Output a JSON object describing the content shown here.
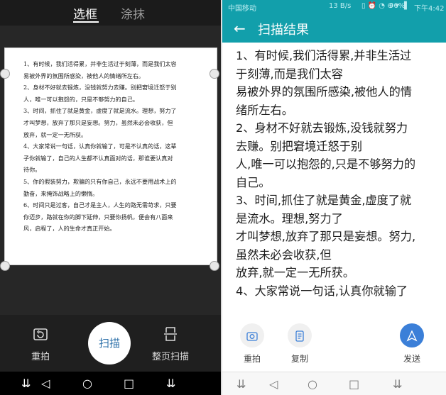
{
  "left": {
    "tabs": [
      {
        "label": "选框"
      },
      {
        "label": "涂抹"
      }
    ],
    "doc_lines": [
      "1、有时候，我们活得累，并非生活过于刻薄，而是我们太容",
      "易被外界的氛围所感染，被他人的情绪所左右。",
      "2、身材不好就去锻炼，没钱就努力去赚。别把窘境迁怒于别",
      "人，唯一可以抱怨的，只是不够努力的自己。",
      "3、时间，抓住了就是黄金，虚度了就是流水。理想，努力了",
      "才叫梦想，放弃了那只是妄想。努力，虽然未必会收获，但",
      "放弃，就一定一无所获。",
      "4、大家常说一句话，认真你就输了，可是不认真的话，这辈",
      "子你就输了，自己的人生都不认真面对的话，那谁要认真对",
      "待你。",
      "5、你的假装努力，欺骗的只有你自己，永远不要用战术上的",
      "勤奋，来掩饰战略上的懒惰。",
      "6、时间只是过客，自己才是主人，人生的路无需苛求，只要",
      "你迈步，路就在你的脚下延伸，只要你扬帆，便会有八面来",
      "风，启程了，人的生命才真正开始。"
    ],
    "bottom": {
      "retake": "重拍",
      "scan": "扫描",
      "full_page": "整页扫描"
    }
  },
  "right": {
    "status": {
      "carrier": "中国移动",
      "speed": "13 B/s",
      "battery": "96%",
      "time": "下午4:42"
    },
    "title": "扫描结果",
    "lines": [
      "1、有时候,我们活得累,并非生活过",
      "于刻薄,而是我们太容",
      "易被外界的氛围所感染,被他人的情",
      "绪所左右。",
      "2、身材不好就去锻炼,没钱就努力",
      "去赚。别把窘境迁怒于别",
      "人,唯一可以抱怨的,只是不够努力的",
      "自己。",
      "3、时间,抓住了就是黄金,虚度了就",
      "是流水。理想,努力了",
      "才叫梦想,放弃了那只是妄想。努力,",
      "虽然未必会收获,但",
      "放弃,就一定一无所获。",
      "4、大家常说一句话,认真你就输了"
    ],
    "actions": {
      "retake": "重拍",
      "copy": "复制",
      "send": "发送"
    }
  },
  "nav": {
    "back": "◁",
    "home": "○",
    "recent": "□",
    "down": "⇊"
  }
}
